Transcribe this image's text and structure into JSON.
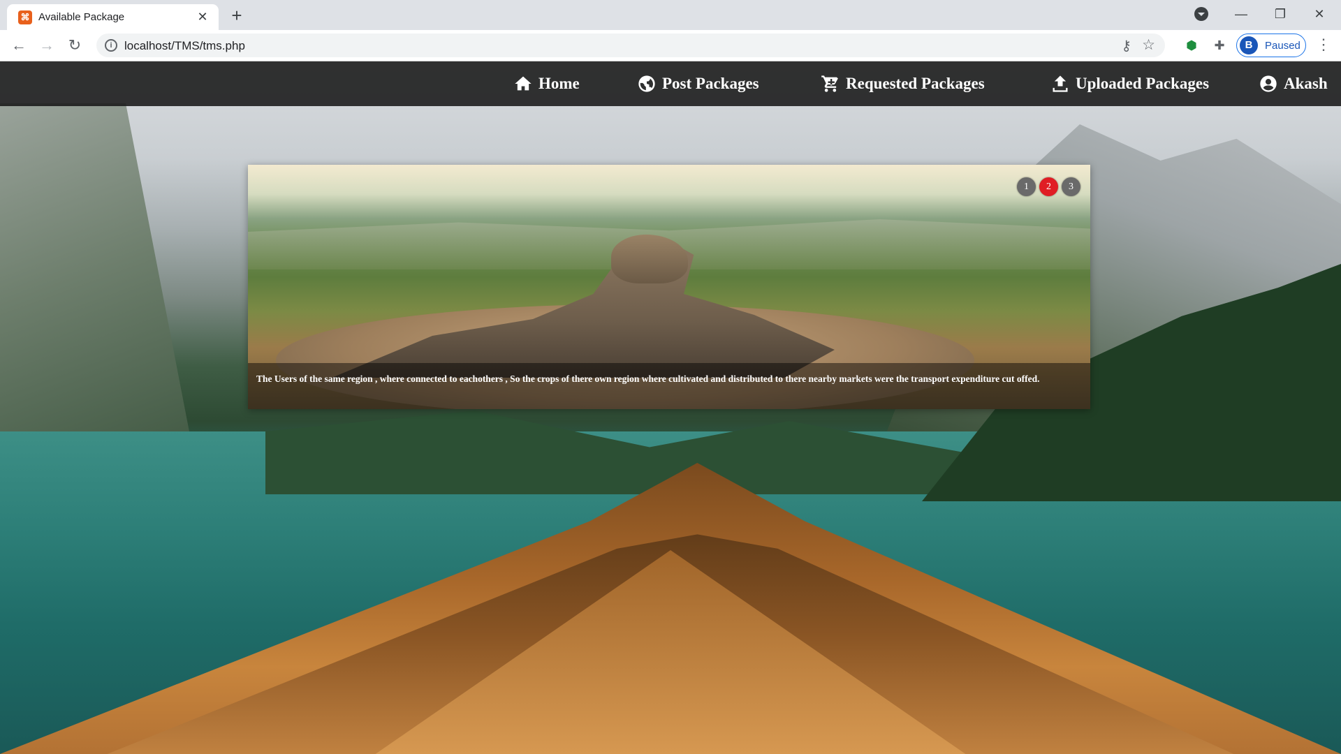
{
  "browser": {
    "tab_title": "Available Package",
    "url": "localhost/TMS/tms.php",
    "profile_initial": "B",
    "profile_status": "Paused"
  },
  "nav": {
    "items": [
      {
        "label": "Home",
        "icon": "home-icon"
      },
      {
        "label": "Post Packages",
        "icon": "globe-icon"
      },
      {
        "label": "Requested Packages",
        "icon": "cart-icon"
      },
      {
        "label": "Uploaded Packages",
        "icon": "upload-icon"
      },
      {
        "label": "Akash",
        "icon": "user-circle-icon"
      }
    ]
  },
  "slider": {
    "caption": "The Users of the same region , where connected to eachothers , So the crops of there own region where cultivated and distributed to there nearby markets were the transport expenditure cut offed.",
    "pages": [
      "1",
      "2",
      "3"
    ],
    "active_page": "2"
  },
  "colors": {
    "nav_bg": "#181818",
    "active_dot": "#e01d24",
    "inactive_dot": "#6a6a6a"
  }
}
